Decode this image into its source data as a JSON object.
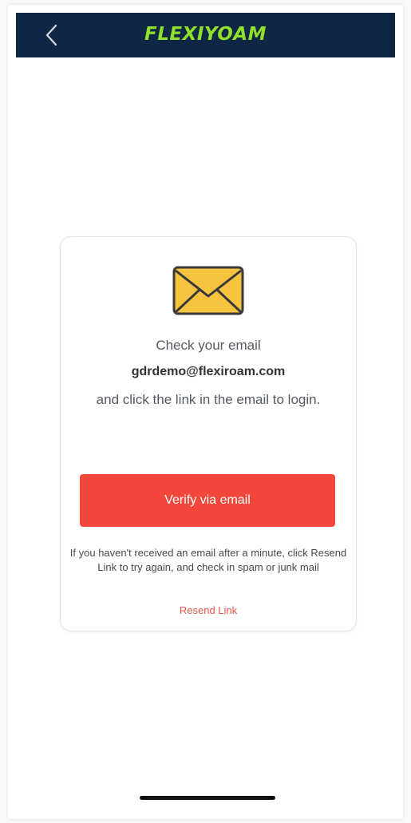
{
  "header": {
    "logo_text": "FLEXIYOAM",
    "back_icon": "chevron-left-icon",
    "background_color": "#0f2744",
    "logo_color": "#8ee02b"
  },
  "card": {
    "icon": "envelope-icon",
    "check_text": "Check your email",
    "email": "gdrdemo@flexiroam.com",
    "instruction": "and click the link in the email to login.",
    "verify_label": "Verify via email",
    "note": "If you haven't received an email after a minute, click Resend Link to try again, and check in spam or junk mail",
    "resend_label": "Resend Link",
    "button_color": "#f4473c",
    "envelope_color": "#f7c43f"
  }
}
